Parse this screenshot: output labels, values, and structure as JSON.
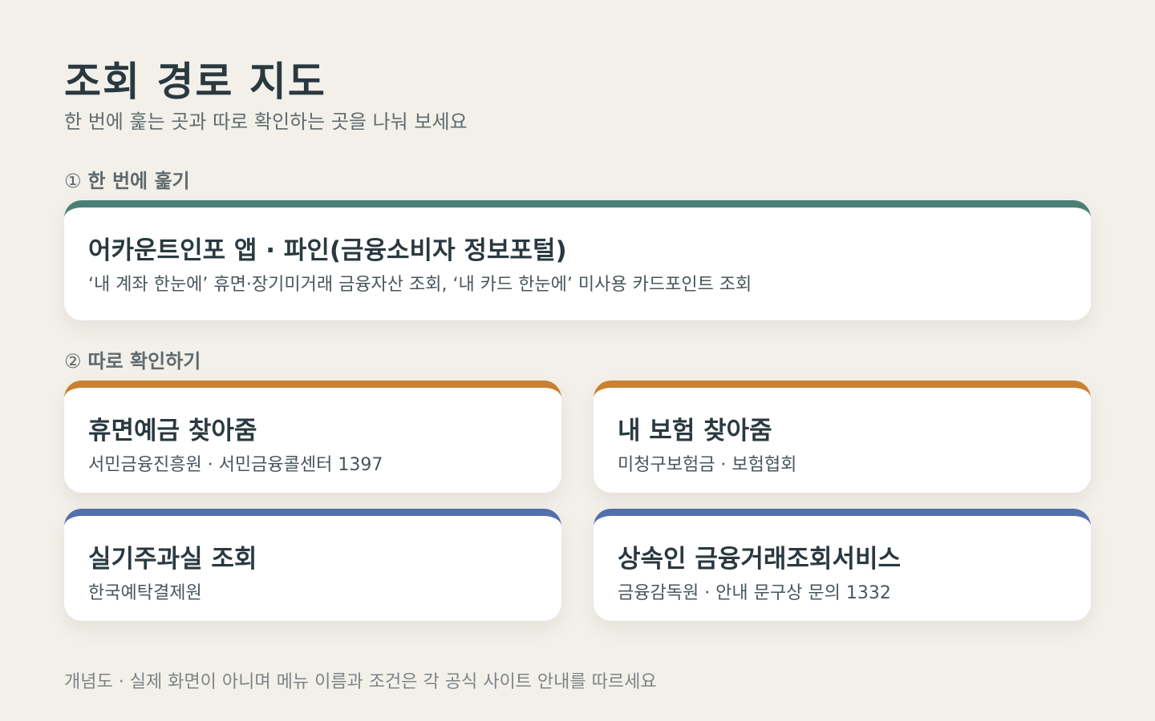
{
  "header": {
    "title": "조회 경로 지도",
    "subtitle": "한 번에 훑는 곳과 따로 확인하는 곳을 나눠 보세요"
  },
  "sections": [
    {
      "number": "①",
      "label": "한 번에 훑기",
      "accent": "#4a7f77",
      "cards": [
        {
          "title": "어카운트인포 앱 · 파인(금융소비자 정보포털)",
          "desc": "‘내 계좌 한눈에’ 휴면·장기미거래 금융자산 조회, ‘내 카드 한눈에’ 미사용 카드포인트 조회"
        }
      ]
    },
    {
      "number": "②",
      "label": "따로 확인하기",
      "cards": [
        {
          "title": "휴면예금 찾아줌",
          "desc": "서민금융진흥원 · 서민금융콜센터 1397",
          "accent": "#c9812f"
        },
        {
          "title": "내 보험 찾아줌",
          "desc": "미청구보험금 · 보험협회",
          "accent": "#c9812f"
        },
        {
          "title": "실기주과실 조회",
          "desc": "한국예탁결제원",
          "accent": "#5270ac"
        },
        {
          "title": "상속인 금융거래조회서비스",
          "desc": "금융감독원 · 안내 문구상 문의 1332",
          "accent": "#5270ac"
        }
      ]
    }
  ],
  "footnote": "개념도 · 실제 화면이 아니며 메뉴 이름과 조건은 각 공식 사이트 안내를 따르세요",
  "colors": {
    "background": "#f3f0ea",
    "teal": "#4a7f77",
    "orange": "#c9812f",
    "blue": "#5270ac"
  }
}
